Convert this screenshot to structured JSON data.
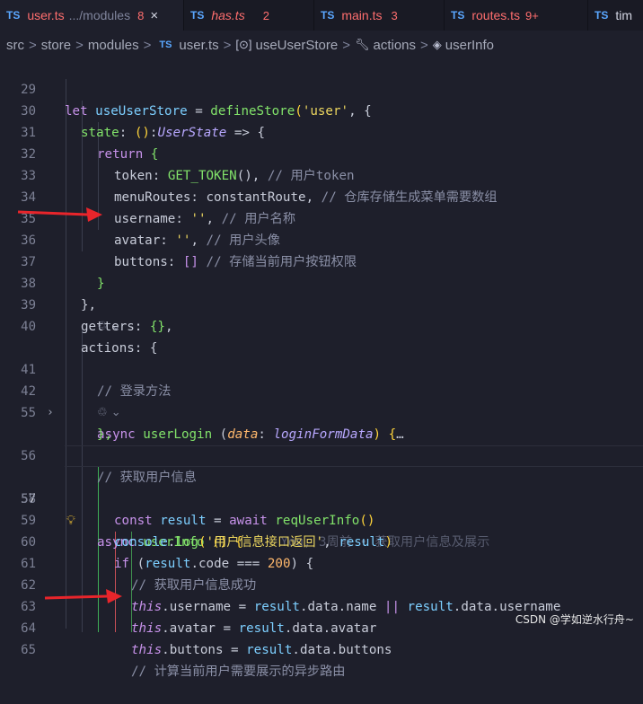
{
  "tabs": [
    {
      "badge": "TS",
      "name": "user.ts",
      "dir": ".../modules",
      "count": "8",
      "close": "×",
      "active": true
    },
    {
      "badge": "TS",
      "name": "has.ts",
      "count": "2"
    },
    {
      "badge": "TS",
      "name": "main.ts",
      "count": "3"
    },
    {
      "badge": "TS",
      "name": "routes.ts",
      "count": "9+"
    },
    {
      "badge": "TS",
      "name": "tim"
    }
  ],
  "breadcrumb": {
    "parts": [
      "src",
      "store",
      "modules"
    ],
    "file_badge": "TS",
    "file": "user.ts",
    "symbol": "useUserStore",
    "actions": "actions",
    "method": "userInfo",
    "separator": ">"
  },
  "line_numbers": [
    "29",
    "30",
    "31",
    "32",
    "33",
    "34",
    "35",
    "36",
    "37",
    "38",
    "39",
    "40",
    "",
    "41",
    "42",
    "55",
    "",
    "56",
    "57",
    "58",
    "59",
    "60",
    "61",
    "62",
    "63",
    "64",
    "65"
  ],
  "code": {
    "l29": [
      "let ",
      "useUserStore",
      " = ",
      "defineStore",
      "(",
      "'user'",
      ", {"
    ],
    "l30": [
      "state",
      ": ",
      "()",
      ":",
      "UserState",
      " => {"
    ],
    "l31": [
      "return",
      " {"
    ],
    "l32": [
      "token",
      ": ",
      "GET_TOKEN",
      "(), ",
      "// 用户token"
    ],
    "l33": [
      "menuRoutes",
      ": ",
      "constantRoute",
      ", ",
      "// 仓库存储生成菜单需要数组"
    ],
    "l34": [
      "username",
      ": ",
      "''",
      ", ",
      "// 用户名称"
    ],
    "l35": [
      "avatar",
      ": ",
      "''",
      ", ",
      "// 用户头像"
    ],
    "l36": [
      "buttons",
      ": ",
      "[]",
      " ",
      "// 存储当前用户按钮权限"
    ],
    "l37": [
      "}"
    ],
    "l38": [
      "},"
    ],
    "l39": [
      "getters",
      ": ",
      "{}",
      ","
    ],
    "l40": [
      "actions",
      ": {"
    ],
    "l41": [
      "// 登录方法"
    ],
    "l42": [
      "async ",
      "userLogin",
      " (",
      "data",
      ": ",
      "loginFormData",
      ") {",
      "…"
    ],
    "l55": [
      "},"
    ],
    "l56": [
      "// 获取用户信息"
    ],
    "l57": [
      "async ",
      "userInfo",
      " () {",
      "You, 3周前 • 获取用户信息及展示"
    ],
    "l58": [
      "const ",
      "result",
      " = ",
      "await ",
      "reqUserInfo",
      "()"
    ],
    "l59": [
      "console",
      ".",
      "log",
      "(",
      "'用户信息接口返回'",
      ", ",
      "result",
      ")"
    ],
    "l60": [
      "if",
      " (",
      "result",
      ".",
      "code",
      " === ",
      "200",
      ") {"
    ],
    "l61": [
      "// 获取用户信息成功"
    ],
    "l62": [
      "this",
      ".",
      "username",
      " = ",
      "result",
      ".",
      "data",
      ".",
      "name",
      " || ",
      "result",
      ".",
      "data",
      ".",
      "username"
    ],
    "l63": [
      "this",
      ".",
      "avatar",
      " = ",
      "result",
      ".",
      "data",
      ".",
      "avatar"
    ],
    "l64": [
      "this",
      ".",
      "buttons",
      " = ",
      "result",
      ".",
      "data",
      ".",
      "buttons"
    ],
    "l65": [
      "// 计算当前用户需要展示的异步路由"
    ]
  },
  "codelens_icon": "refresh-icon",
  "watermark": "CSDN @学如逆水行舟~",
  "colors": {
    "background": "#1e1f2b",
    "keyword": "#c792ea",
    "function": "#82e36a",
    "string": "#ecd65f",
    "comment": "#8a8fa6",
    "arrow": "#e8252b"
  }
}
